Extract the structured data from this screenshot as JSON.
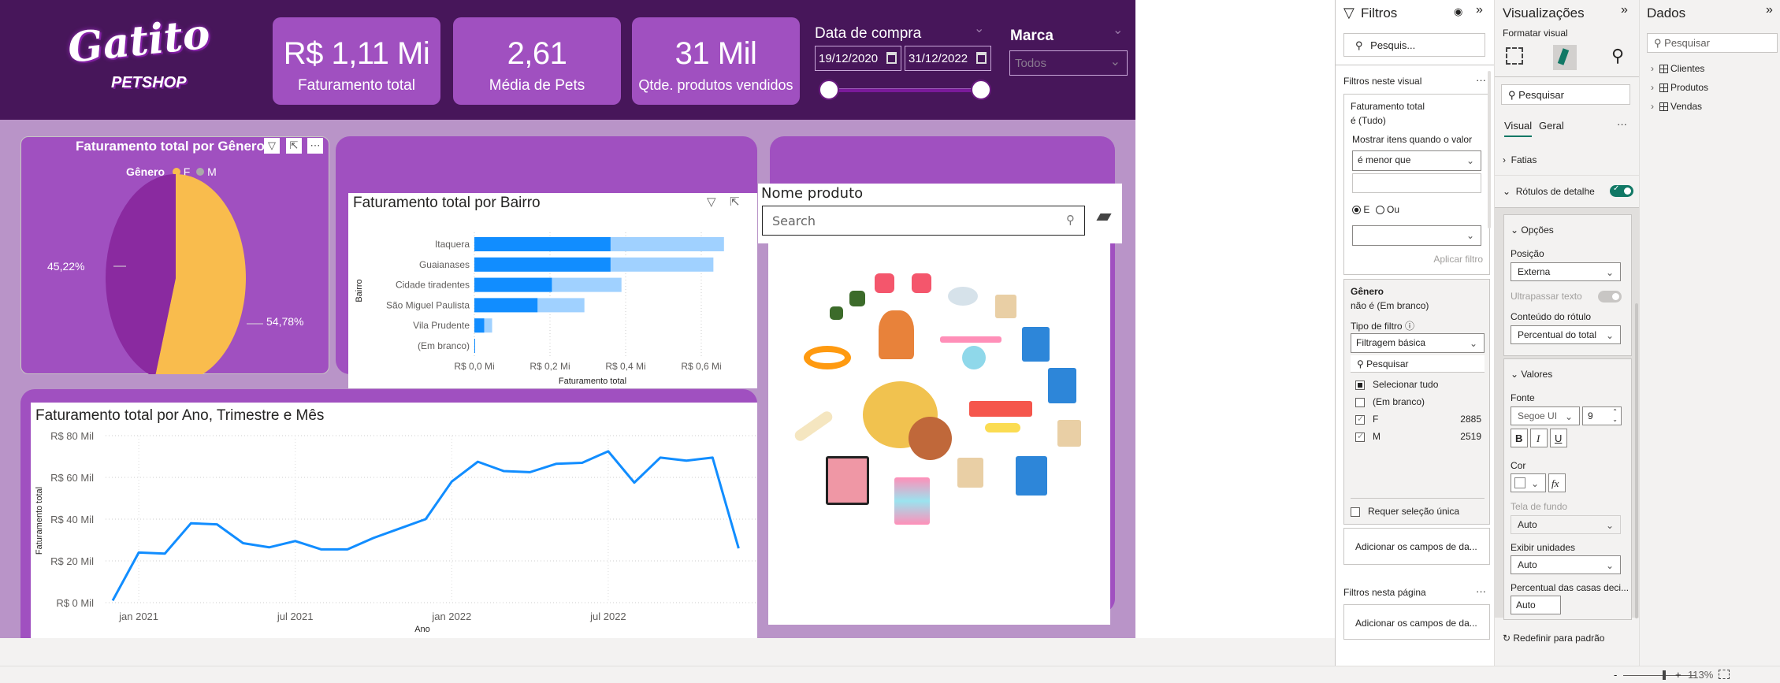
{
  "header": {
    "logo": {
      "line1": "Gatito",
      "line2": "PETSHOP"
    },
    "kpis": [
      {
        "value": "R$ 1,11 Mi",
        "label": "Faturamento total"
      },
      {
        "value": "2,61",
        "label": "Média de Pets"
      },
      {
        "value": "31 Mil",
        "label": "Qtde. produtos vendidos"
      }
    ],
    "date_slicer": {
      "title": "Data de compra",
      "start": "19/12/2020",
      "end": "31/12/2022"
    },
    "brand_slicer": {
      "title": "Marca",
      "value": "Todos"
    }
  },
  "pie_visual": {
    "title": "Faturamento total por Gênero",
    "legend_title": "Gênero",
    "colors": {
      "F": "#f9bc4d",
      "M": "#8a2aa0"
    }
  },
  "bar_visual": {
    "title": "Faturamento total por Bairro"
  },
  "line_visual": {
    "title": "Faturamento total por Ano, Trimestre e Mês"
  },
  "product_slicer": {
    "title": "Nome produto",
    "search_placeholder": "Search"
  },
  "chart_data": [
    {
      "type": "pie",
      "title": "Faturamento total por Gênero",
      "legend": [
        "F",
        "M"
      ],
      "legend_title": "Gênero",
      "values": [
        54.78,
        45.22
      ],
      "labels": [
        "54,78%",
        "45,22%"
      ]
    },
    {
      "type": "bar",
      "orientation": "horizontal",
      "title": "Faturamento total por Bairro",
      "xlabel": "Faturamento total",
      "ylabel": "Bairro",
      "categories": [
        "Itaquera",
        "Guaianases",
        "Cidade tiradentes",
        "São Miguel Paulista",
        "Vila Prudente",
        "(Em branco)"
      ],
      "series": [
        {
          "values": [
            0.36,
            0.36,
            0.205,
            0.167,
            0.026,
            0.0
          ],
          "color": "#118dff"
        },
        {
          "values": [
            0.66,
            0.632,
            0.389,
            0.291,
            0.047,
            0.002
          ],
          "color": "#a0d1ff"
        }
      ],
      "xticks": [
        "R$ 0,0 Mi",
        "R$ 0,2 Mi",
        "R$ 0,4 Mi",
        "R$ 0,6 Mi"
      ],
      "xlim": [
        0,
        0.66
      ],
      "unit": "R$ Mi",
      "grid": true
    },
    {
      "type": "line",
      "title": "Faturamento total por Ano, Trimestre e Mês",
      "xlabel": "Ano",
      "ylabel": "Faturamento total",
      "x": [
        "2020-12",
        "2021-01",
        "2021-02",
        "2021-03",
        "2021-04",
        "2021-05",
        "2021-06",
        "2021-07",
        "2021-08",
        "2021-09",
        "2021-10",
        "2021-11",
        "2021-12",
        "2022-01",
        "2022-02",
        "2022-03",
        "2022-04",
        "2022-05",
        "2022-06",
        "2022-07",
        "2022-08",
        "2022-09",
        "2022-10",
        "2022-11",
        "2022-12"
      ],
      "values": [
        1,
        24,
        23.5,
        38,
        37.5,
        28.5,
        26.5,
        29.5,
        25.5,
        25.5,
        31,
        35.5,
        40,
        58,
        67.5,
        63,
        62.5,
        66.5,
        67,
        72.5,
        57.5,
        69.5,
        68,
        69.5,
        26
      ],
      "unit": "R$ Mil",
      "ylim": [
        0,
        80
      ],
      "yticks": [
        "R$ 0 Mil",
        "R$ 20 Mil",
        "R$ 40 Mil",
        "R$ 60 Mil",
        "R$ 80 Mil"
      ],
      "xticks": [
        "jan 2021",
        "jul 2021",
        "jan 2022",
        "jul 2022"
      ],
      "color": "#118dff",
      "grid": true
    }
  ],
  "filters": {
    "title": "Filtros",
    "search": "Pesquis...",
    "section_visual": "Filtros neste visual",
    "fat": {
      "name": "Faturamento total",
      "state": "é (Tudo)",
      "show_label": "Mostrar itens quando o valor",
      "operator": "é menor que",
      "and": "E",
      "or": "Ou",
      "apply": "Aplicar filtro"
    },
    "genero": {
      "name": "Gênero",
      "state": "não é (Em branco)",
      "type_label": "Tipo de filtro",
      "type": "Filtragem básica",
      "search": "Pesquisar",
      "items": [
        {
          "label": "Selecionar tudo",
          "count": "",
          "state": "partial"
        },
        {
          "label": "(Em branco)",
          "count": "",
          "state": "off"
        },
        {
          "label": "F",
          "count": "2885",
          "state": "on"
        },
        {
          "label": "M",
          "count": "2519",
          "state": "on"
        }
      ],
      "single": "Requer seleção única"
    },
    "add_fields": "Adicionar os campos de da...",
    "section_page": "Filtros nesta página",
    "add_fields_page": "Adicionar os campos de da..."
  },
  "viz": {
    "title": "Visualizações",
    "subtitle": "Formatar visual",
    "search": "Pesquisar",
    "tabs": [
      "Visual",
      "Geral"
    ],
    "fatias": "Fatias",
    "rotulos": "Rótulos de detalhe",
    "rotulos_on": true,
    "opcoes": {
      "title": "Opções",
      "pos_label": "Posição",
      "pos": "Externa",
      "overflow": "Ultrapassar texto",
      "content_label": "Conteúdo do rótulo",
      "content": "Percentual do total"
    },
    "valores": {
      "title": "Valores",
      "font_label": "Fonte",
      "font": "Segoe UI",
      "size": "9",
      "bold": "B",
      "italic": "I",
      "underline": "U",
      "color_label": "Cor",
      "fx": "fx",
      "bg_label": "Tela de fundo",
      "bg": "Auto",
      "units_label": "Exibir unidades",
      "units": "Auto",
      "decimals_label": "Percentual das casas deci...",
      "decimals": "Auto"
    },
    "reset": "Redefinir para padrão"
  },
  "dados": {
    "title": "Dados",
    "search": "Pesquisar",
    "tables": [
      "Clientes",
      "Produtos",
      "Vendas"
    ]
  },
  "status": {
    "zoom": "113%",
    "minus": "-",
    "plus": "+"
  }
}
